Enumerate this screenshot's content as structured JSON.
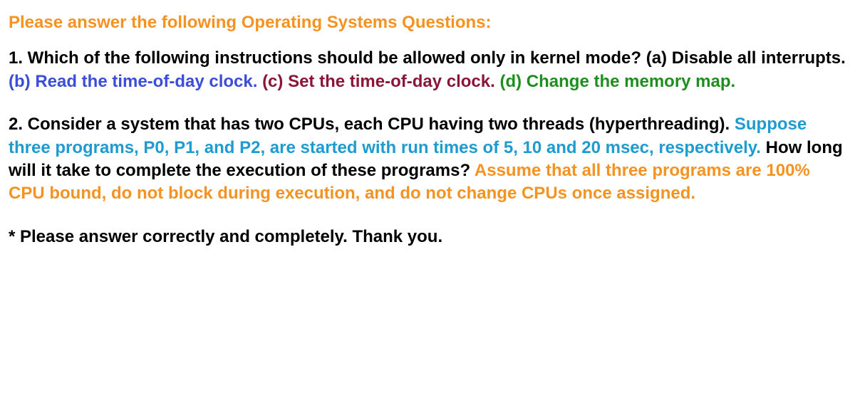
{
  "title": "Please answer the following Operating Systems Questions:",
  "q1": {
    "stem": "1. Which of the following instructions should be allowed only in kernel mode? (a) Disable all interrupts. ",
    "optB": "(b) Read the time-of-day clock. ",
    "optC": "(c) Set the time-of-day clock. ",
    "optD": "(d) Change the memory map."
  },
  "q2": {
    "part1": "2. Consider a system that has two CPUs, each CPU having two threads (hyperthreading). ",
    "part2": "Suppose three programs, P0, P1, and P2, are started with run times of 5, 10 and 20 msec, respectively. ",
    "part3": "How long will it take to complete the execution of these programs? ",
    "part4": "Assume that all three programs are 100% CPU bound, do not block during execution, and do not change CPUs once assigned."
  },
  "footer": "* Please answer correctly and completely. Thank you."
}
